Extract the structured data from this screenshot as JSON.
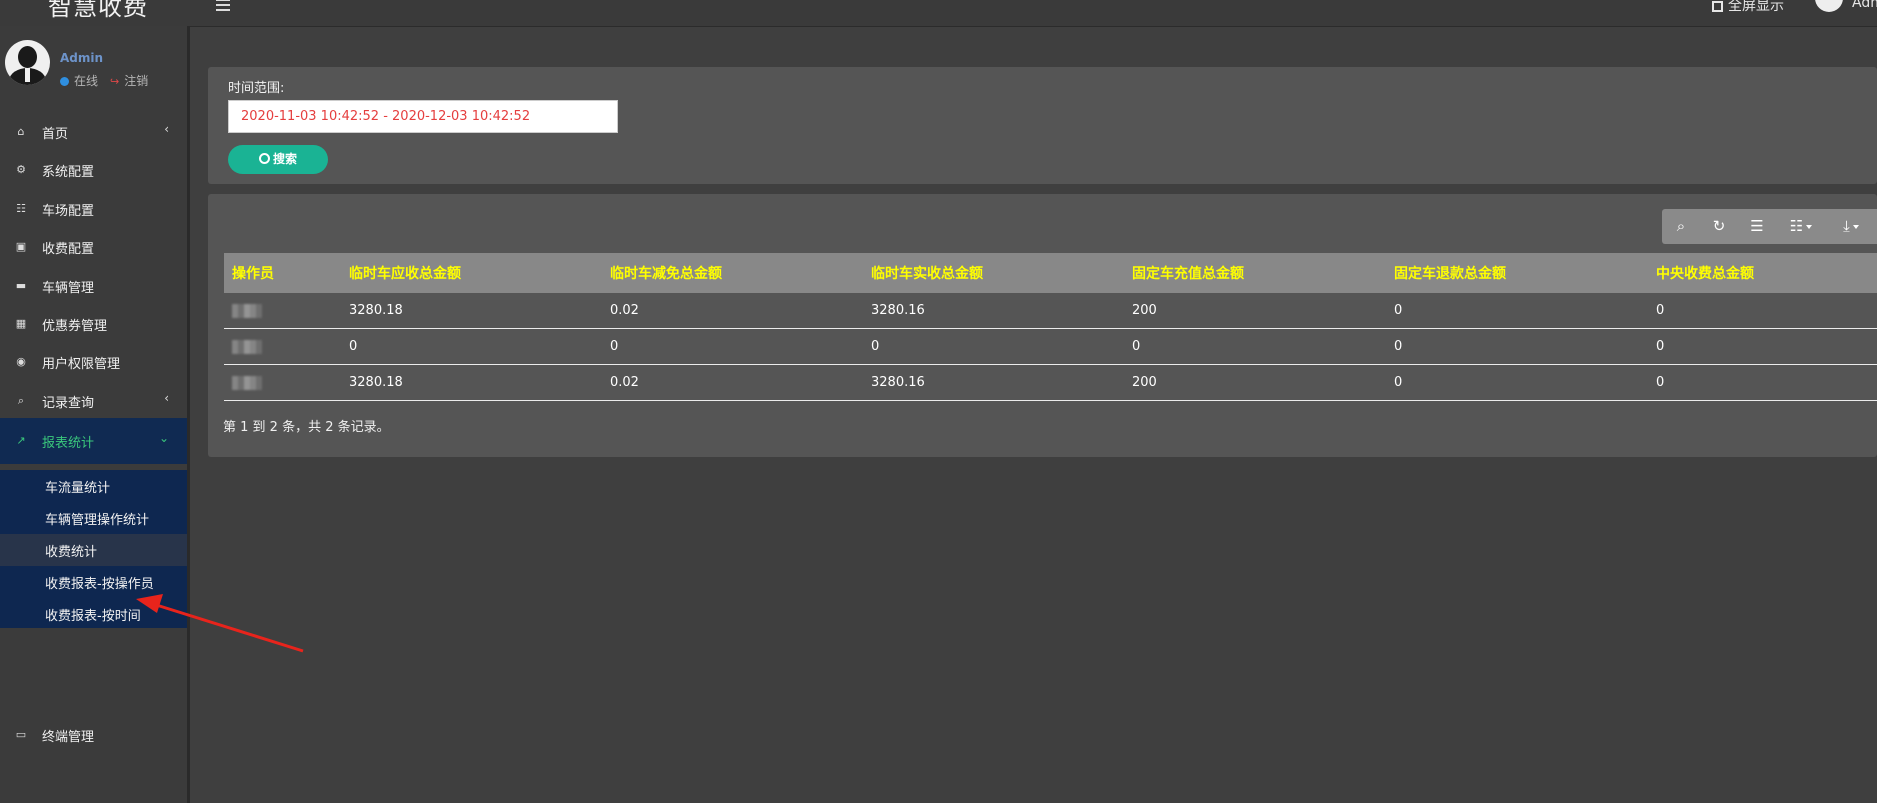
{
  "app": {
    "title": "智慧收费"
  },
  "header": {
    "fullscreen_label": "全屏显示",
    "user_name": "Admin"
  },
  "sidebar": {
    "profile": {
      "name": "Admin",
      "online_label": "在线",
      "logout_label": "注销"
    },
    "items": [
      {
        "label": "首页",
        "icon": "home-icon"
      },
      {
        "label": "系统配置",
        "icon": "cogs-icon"
      },
      {
        "label": "车场配置",
        "icon": "file-icon"
      },
      {
        "label": "收费配置",
        "icon": "money-icon"
      },
      {
        "label": "车辆管理",
        "icon": "car-icon"
      },
      {
        "label": "优惠券管理",
        "icon": "calendar-icon"
      },
      {
        "label": "用户权限管理",
        "icon": "user-circle-icon"
      },
      {
        "label": "记录查询",
        "icon": "search-icon"
      },
      {
        "label": "报表统计",
        "icon": "line-chart-icon"
      },
      {
        "label": "终端管理",
        "icon": "desktop-icon"
      }
    ],
    "submenu": [
      {
        "label": "车流量统计"
      },
      {
        "label": "车辆管理操作统计"
      },
      {
        "label": "收费统计"
      },
      {
        "label": "收费报表-按操作员"
      },
      {
        "label": "收费报表-按时间"
      }
    ]
  },
  "filter": {
    "label": "时间范围:",
    "value": "2020-11-03 10:42:52 - 2020-12-03 10:42:52",
    "search_label": "搜索"
  },
  "table": {
    "columns": [
      "操作员",
      "临时车应收总金额",
      "临时车减免总金额",
      "临时车实收总金额",
      "固定车充值总金额",
      "固定车退款总金额",
      "中央收费总金额"
    ],
    "rows": [
      [
        "",
        "3280.18",
        "0.02",
        "3280.16",
        "200",
        "0",
        "0"
      ],
      [
        "",
        "0",
        "0",
        "0",
        "0",
        "0",
        "0"
      ],
      [
        "",
        "3280.18",
        "0.02",
        "3280.16",
        "200",
        "0",
        "0"
      ]
    ],
    "summary": "第 1 到 2 条，共 2 条记录。"
  },
  "colors": {
    "accent": "#1ab394",
    "active_nav": "#3ac77c",
    "submenu_bg": "#0e2750",
    "header_text": "#ffff00",
    "date_text": "#e53e3e"
  }
}
